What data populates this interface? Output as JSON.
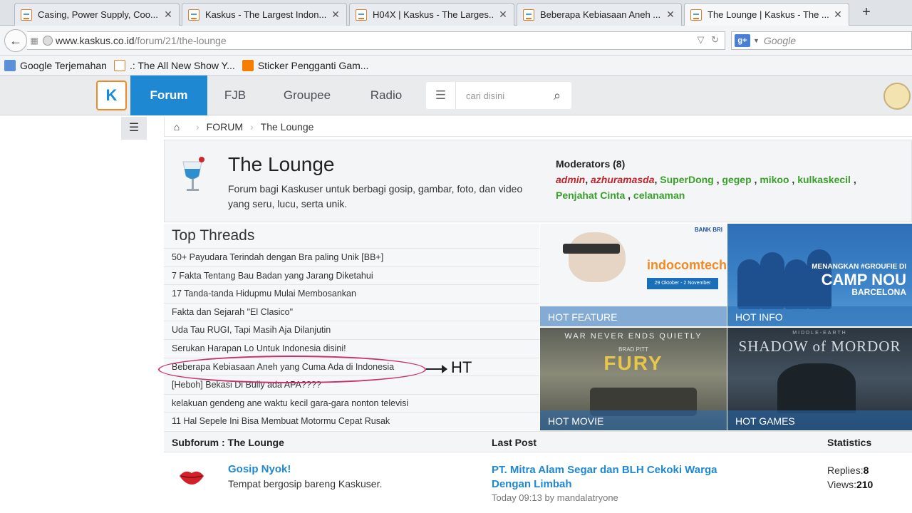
{
  "browser": {
    "tabs": [
      {
        "title": "Casing, Power Supply, Coo...",
        "active": false
      },
      {
        "title": "Kaskus - The Largest Indon...",
        "active": false
      },
      {
        "title": "H04X | Kaskus - The Larges...",
        "active": false
      },
      {
        "title": "Beberapa Kebiasaan Aneh ...",
        "active": false
      },
      {
        "title": "The Lounge | Kaskus - The ...",
        "active": true
      }
    ],
    "url_host": "www.kaskus.co.id",
    "url_path": "/forum/21/the-lounge",
    "search_engine": "Google",
    "search_placeholder": "Google",
    "bookmarks": [
      {
        "label": "Google Terjemahan",
        "icon": "translate-icon"
      },
      {
        "label": ".: The All New Show Y...",
        "icon": "kaskus-icon"
      },
      {
        "label": "Sticker Pengganti Gam...",
        "icon": "blogger-icon"
      }
    ]
  },
  "site": {
    "logo_text": "K",
    "nav": [
      {
        "label": "Forum",
        "active": true
      },
      {
        "label": "FJB",
        "active": false
      },
      {
        "label": "Groupee",
        "active": false
      },
      {
        "label": "Radio",
        "active": false
      }
    ],
    "search_placeholder": "cari disini",
    "accent_color": "#1f88d2"
  },
  "breadcrumb": {
    "items": [
      "FORUM",
      "The Lounge"
    ]
  },
  "forum": {
    "title": "The Lounge",
    "description": "Forum bagi Kaskuser untuk berbagi gosip, gambar, foto, dan video yang seru, lucu, serta unik.",
    "moderators_label": "Moderators (8)",
    "admins": [
      "admin",
      "azhuramasda"
    ],
    "moderators": [
      "SuperDong",
      "gegep",
      "mikoo",
      "kulkaskecil",
      "Penjahat Cinta",
      "celanaman"
    ]
  },
  "top_threads": {
    "heading": "Top Threads",
    "items": [
      "50+ Payudara Terindah dengan Bra paling Unik [BB+]",
      "7 Fakta Tentang Bau Badan yang Jarang Diketahui",
      "17 Tanda-tanda Hidupmu Mulai Membosankan",
      "Fakta dan Sejarah \"El Clasico\"",
      "Uda Tau RUGI, Tapi Masih Aja Dilanjutin",
      "Serukan Harapan Lo Untuk Indonesia disini!",
      "Beberapa Kebiasaan Aneh yang Cuma Ada di Indonesia",
      "[Heboh] Bekasi Di Bully ada APA????",
      "kelakuan gendeng ane waktu kecil gara-gara nonton televisi",
      "11 Hal Sepele Ini Bisa Membuat Motormu Cepat Rusak"
    ]
  },
  "annotation": {
    "label": "HT",
    "color": "#c8336d"
  },
  "promos": [
    {
      "caption": "HOT FEATURE",
      "headline": "indocomtech",
      "sub": "BANK BRI",
      "extra": "29 Oktober - 2 November"
    },
    {
      "caption": "HOT INFO",
      "headline": "MENANGKAN #GROUFIE DI",
      "sub": "CAMP NOU",
      "extra": "BARCELONA"
    },
    {
      "caption": "HOT MOVIE",
      "headline": "FURY",
      "sub": "WAR NEVER ENDS QUIETLY",
      "extra": "BRAD PITT"
    },
    {
      "caption": "HOT GAMES",
      "headline": "SHADOW of MORDOR",
      "sub": "MIDDLE-EARTH",
      "extra": ""
    }
  ],
  "subforum_table": {
    "col_subforum": "Subforum : The Lounge",
    "col_last_post": "Last Post",
    "col_statistics": "Statistics",
    "rows": [
      {
        "name": "Gosip Nyok!",
        "description": "Tempat bergosip bareng Kaskuser.",
        "last_post_title": "PT. Mitra Alam Segar dan BLH Cekoki Warga Dengan Limbah",
        "last_post_meta": "Today 09:13 by mandalatryone",
        "replies_label": "Replies:",
        "replies": "8",
        "views_label": "Views:",
        "views": "210"
      }
    ]
  }
}
